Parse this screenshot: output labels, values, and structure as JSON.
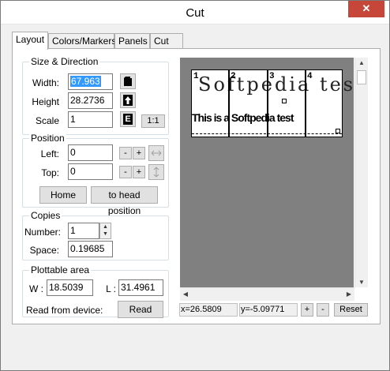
{
  "window": {
    "title": "Cut",
    "close_glyph": "✕"
  },
  "tabs": [
    {
      "label": "Layout",
      "active": true
    },
    {
      "label": "Colors/Markers",
      "active": false
    },
    {
      "label": "Panels",
      "active": false
    },
    {
      "label": "Cut",
      "active": false
    }
  ],
  "size_direction": {
    "title": "Size & Direction",
    "width_label": "Width:",
    "width_value": "67.963",
    "height_label": "Height",
    "height_value": "28.2736",
    "scale_label": "Scale",
    "scale_value": "1",
    "scale_reset_label": "1:1",
    "icons": [
      "page-icon",
      "arrow-up-icon",
      "e-letter-icon"
    ],
    "e_glyph": "E"
  },
  "position": {
    "title": "Position",
    "left_label": "Left:",
    "left_value": "0",
    "top_label": "Top:",
    "top_value": "0",
    "minus_label": "-",
    "plus_label": "+",
    "home_label": "Home",
    "head_label": "to head position"
  },
  "copies": {
    "title": "Copies",
    "number_label": "Number:",
    "number_value": "1",
    "space_label": "Space:",
    "space_value": "0.19685"
  },
  "plottable": {
    "title": "Plottable area",
    "w_label": "W :",
    "w_value": "18.5039",
    "l_label": "L :",
    "l_value": "31.4961",
    "read_from_label": "Read from device:",
    "read_button": "Read"
  },
  "preview": {
    "page_numbers": [
      "1",
      "2",
      "3",
      "4"
    ],
    "handwritten_text": "Softpedia test",
    "printed_text": "This is a Softpedia test"
  },
  "status": {
    "x_readout": "x=26.5809",
    "y_readout": "y=-5.09771",
    "zoom_in": "+",
    "zoom_out": "-",
    "reset_label": "Reset"
  },
  "colors": {
    "selection": "#3399ff",
    "close": "#c7463a",
    "preview_bg": "#808080"
  }
}
